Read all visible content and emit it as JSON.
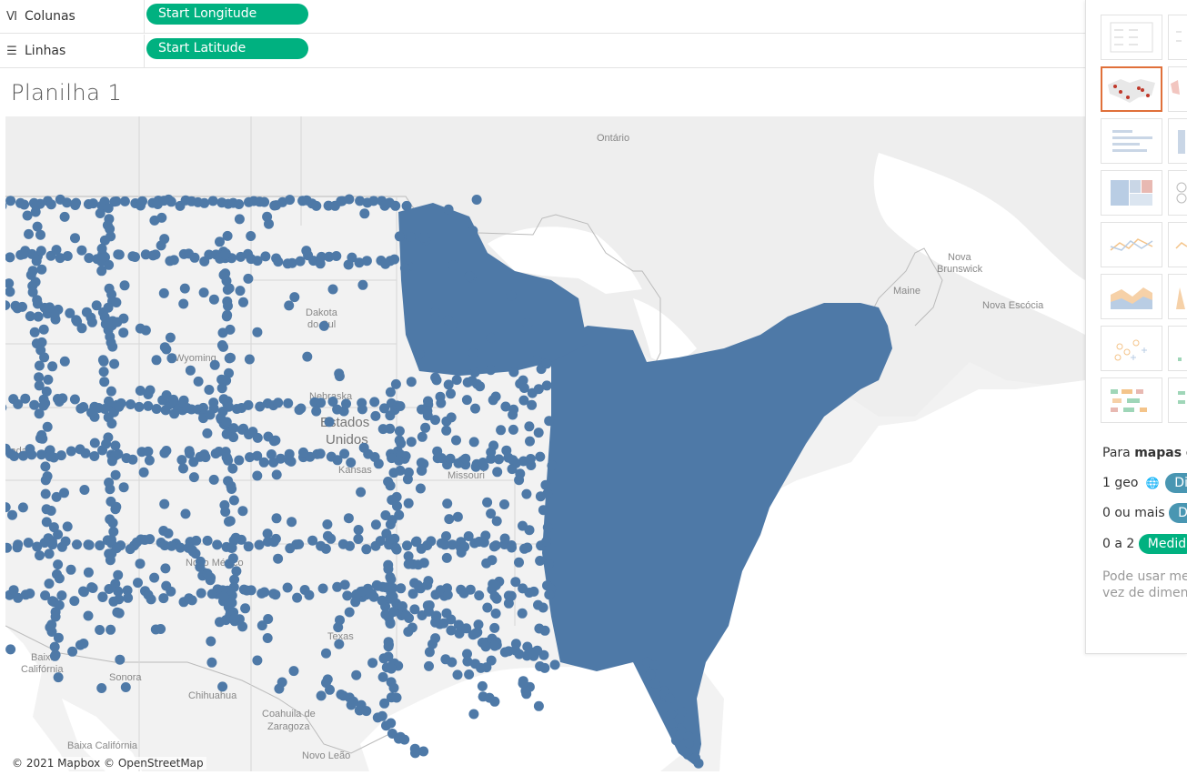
{
  "shelves": {
    "columns": {
      "label": "Colunas",
      "icon": "columns-icon",
      "pill": "Start Longitude"
    },
    "rows": {
      "label": "Linhas",
      "icon": "rows-icon",
      "pill": "Start Latitude"
    }
  },
  "sheet": {
    "title": "Planilha 1"
  },
  "map": {
    "attribution": "© 2021 Mapbox © OpenStreetMap",
    "point_color": "#4e79a7",
    "labels": {
      "ontario": "Ontário",
      "nova_brunswick_1": "Nova",
      "nova_brunswick_2": "Brunswick",
      "nova_escocia": "Nova Escócia",
      "dakota_1": "Dakota",
      "dakota_2": "do Sul",
      "nebraska": "Nebraska",
      "eua_1": "Estados",
      "eua_2": "Unidos",
      "kansas": "Kansas",
      "missouri": "Missouri",
      "texas": "Texas",
      "novo_mexico": "Novo México",
      "wyoming": "Wyoming",
      "nevada": "vada",
      "baixa_1": "Baixa",
      "baixa_2": "Califórnia",
      "sonora": "Sonora",
      "chihuahua": "Chihuahua",
      "coahuila_1": "Coahuila de",
      "coahuila_2": "Zaragoza",
      "baixa_cal_sul": "Baixa Califórnia",
      "novo_leao": "Novo Leão",
      "maine": "Maine"
    }
  },
  "show_me": {
    "hint_title_prefix": "Para ",
    "hint_title_bold": "mapas d",
    "req1_text": "1 geo",
    "req1_pill": "Dir",
    "req2_text": "0 ou mais",
    "req2_pill": "Di",
    "req3_text": "0 a 2",
    "req3_pill": "Medid",
    "note_line1": "Pode usar me",
    "note_line2": "vez de dimens",
    "dimension_color": "#4996b2",
    "measure_color": "#00b180"
  }
}
